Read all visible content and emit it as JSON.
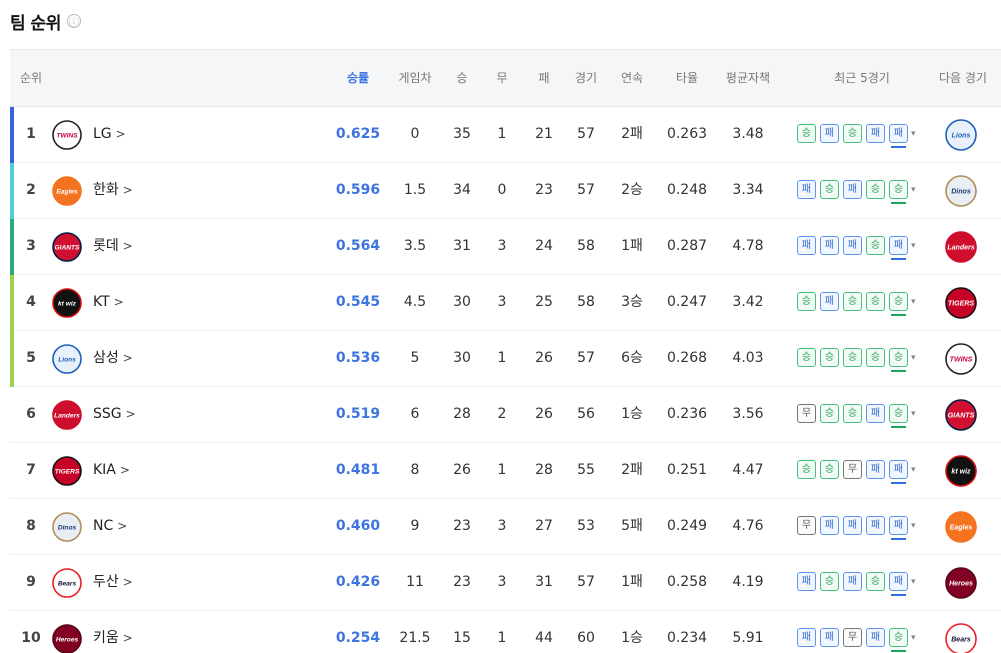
{
  "header": {
    "title": "팀 순위",
    "info_icon": "ⓘ"
  },
  "columns": {
    "rank": "순위",
    "rate": "승률",
    "gb": "게임차",
    "w": "승",
    "d": "무",
    "l": "패",
    "gp": "경기",
    "streak": "연속",
    "avg": "타율",
    "era": "평균자책",
    "last5": "최근 5경기",
    "next": "다음 경기"
  },
  "result_labels": {
    "W": "승",
    "L": "패",
    "D": "무"
  },
  "colors": {
    "accent": "#3d74e0",
    "win": "#22a35a",
    "loss": "#2f6fd6",
    "draw": "#555555",
    "rank_bars": [
      "#3b5fe0",
      "#4fcfd8",
      "#2aaa78",
      "#9ed14d",
      "#9ed14d"
    ]
  },
  "teams": [
    {
      "rank": "1",
      "name": "LG",
      "logo": "twins",
      "rate": "0.625",
      "gb": "0",
      "w": "35",
      "d": "1",
      "l": "21",
      "gp": "57",
      "streak": "2패",
      "avg": "0.263",
      "era": "3.48",
      "last5": [
        "W",
        "L",
        "W",
        "L",
        "L"
      ],
      "next": "lions"
    },
    {
      "rank": "2",
      "name": "한화",
      "logo": "eagles",
      "rate": "0.596",
      "gb": "1.5",
      "w": "34",
      "d": "0",
      "l": "23",
      "gp": "57",
      "streak": "2승",
      "avg": "0.248",
      "era": "3.34",
      "last5": [
        "L",
        "W",
        "L",
        "W",
        "W"
      ],
      "next": "dinos"
    },
    {
      "rank": "3",
      "name": "롯데",
      "logo": "giants",
      "rate": "0.564",
      "gb": "3.5",
      "w": "31",
      "d": "3",
      "l": "24",
      "gp": "58",
      "streak": "1패",
      "avg": "0.287",
      "era": "4.78",
      "last5": [
        "L",
        "L",
        "L",
        "W",
        "L"
      ],
      "next": "landers"
    },
    {
      "rank": "4",
      "name": "KT",
      "logo": "ktwiz",
      "rate": "0.545",
      "gb": "4.5",
      "w": "30",
      "d": "3",
      "l": "25",
      "gp": "58",
      "streak": "3승",
      "avg": "0.247",
      "era": "3.42",
      "last5": [
        "W",
        "L",
        "W",
        "W",
        "W"
      ],
      "next": "tigers"
    },
    {
      "rank": "5",
      "name": "삼성",
      "logo": "lions",
      "rate": "0.536",
      "gb": "5",
      "w": "30",
      "d": "1",
      "l": "26",
      "gp": "57",
      "streak": "6승",
      "avg": "0.268",
      "era": "4.03",
      "last5": [
        "W",
        "W",
        "W",
        "W",
        "W"
      ],
      "next": "twins"
    },
    {
      "rank": "6",
      "name": "SSG",
      "logo": "landers",
      "rate": "0.519",
      "gb": "6",
      "w": "28",
      "d": "2",
      "l": "26",
      "gp": "56",
      "streak": "1승",
      "avg": "0.236",
      "era": "3.56",
      "last5": [
        "D",
        "W",
        "W",
        "L",
        "W"
      ],
      "next": "giants"
    },
    {
      "rank": "7",
      "name": "KIA",
      "logo": "tigers",
      "rate": "0.481",
      "gb": "8",
      "w": "26",
      "d": "1",
      "l": "28",
      "gp": "55",
      "streak": "2패",
      "avg": "0.251",
      "era": "4.47",
      "last5": [
        "W",
        "W",
        "D",
        "L",
        "L"
      ],
      "next": "ktwiz"
    },
    {
      "rank": "8",
      "name": "NC",
      "logo": "dinos",
      "rate": "0.460",
      "gb": "9",
      "w": "23",
      "d": "3",
      "l": "27",
      "gp": "53",
      "streak": "5패",
      "avg": "0.249",
      "era": "4.76",
      "last5": [
        "D",
        "L",
        "L",
        "L",
        "L"
      ],
      "next": "eagles"
    },
    {
      "rank": "9",
      "name": "두산",
      "logo": "bears",
      "rate": "0.426",
      "gb": "11",
      "w": "23",
      "d": "3",
      "l": "31",
      "gp": "57",
      "streak": "1패",
      "avg": "0.258",
      "era": "4.19",
      "last5": [
        "L",
        "W",
        "L",
        "W",
        "L"
      ],
      "next": "heroes"
    },
    {
      "rank": "10",
      "name": "키움",
      "logo": "heroes",
      "rate": "0.254",
      "gb": "21.5",
      "w": "15",
      "d": "1",
      "l": "44",
      "gp": "60",
      "streak": "1승",
      "avg": "0.234",
      "era": "5.91",
      "last5": [
        "L",
        "L",
        "D",
        "L",
        "W"
      ],
      "next": "bears"
    }
  ],
  "logos": {
    "twins": {
      "text": "TWINS",
      "fg": "#c30452",
      "bg": "#ffffff",
      "ring": "#222222"
    },
    "eagles": {
      "text": "Eagles",
      "fg": "#ffffff",
      "bg": "#f37321",
      "ring": "#f37321"
    },
    "giants": {
      "text": "GIANTS",
      "fg": "#ffffff",
      "bg": "#d00f31",
      "ring": "#041e42"
    },
    "ktwiz": {
      "text": "kt wiz",
      "fg": "#ffffff",
      "bg": "#111111",
      "ring": "#d60c0c"
    },
    "lions": {
      "text": "Lions",
      "fg": "#1c5fb8",
      "bg": "#e8f0fb",
      "ring": "#1c5fb8"
    },
    "landers": {
      "text": "Landers",
      "fg": "#ffffff",
      "bg": "#ce0e2d",
      "ring": "#ce0e2d"
    },
    "tigers": {
      "text": "TIGERS",
      "fg": "#ffffff",
      "bg": "#c70125",
      "ring": "#111111"
    },
    "dinos": {
      "text": "Dinos",
      "fg": "#1d3a6e",
      "bg": "#e9edf4",
      "ring": "#b08d57"
    },
    "bears": {
      "text": "Bears",
      "fg": "#131230",
      "bg": "#ffffff",
      "ring": "#ed1c24"
    },
    "heroes": {
      "text": "Heroes",
      "fg": "#ffffff",
      "bg": "#820024",
      "ring": "#570514"
    }
  }
}
